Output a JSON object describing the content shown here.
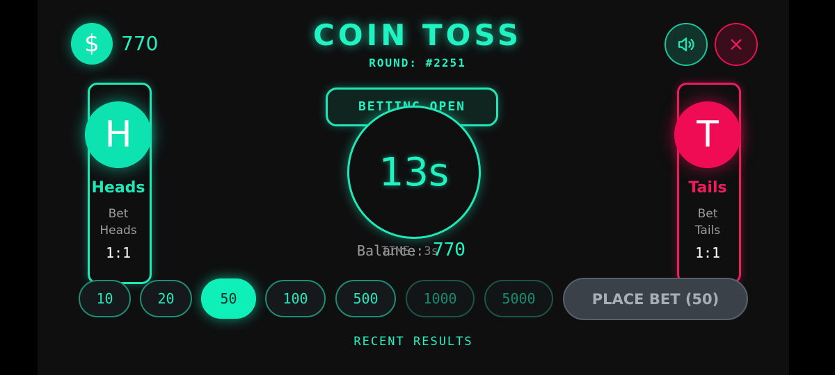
{
  "header": {
    "title": "COIN TOSS",
    "round": "ROUND: #2251",
    "balance": "770",
    "currency_symbol": "$",
    "sound_icon": "speaker-icon",
    "close_icon": "close-icon"
  },
  "heads": {
    "letter": "H",
    "name": "Heads",
    "bet_line1": "Bet",
    "bet_line2": "Heads",
    "odds": "1:1",
    "color": "#1fe8b8"
  },
  "tails": {
    "letter": "T",
    "name": "Tails",
    "bet_line1": "Bet",
    "bet_line2": "Tails",
    "odds": "1:1",
    "color": "#ef1b5e"
  },
  "center": {
    "status": "BETTING OPEN",
    "timer": "13s",
    "balance_label": "Balance:",
    "balance_value": "770",
    "time_label": "TIME: 3s"
  },
  "chips": [
    {
      "label": "10",
      "state": "normal"
    },
    {
      "label": "20",
      "state": "normal"
    },
    {
      "label": "50",
      "state": "selected"
    },
    {
      "label": "100",
      "state": "normal"
    },
    {
      "label": "500",
      "state": "normal"
    },
    {
      "label": "1000",
      "state": "disabled"
    },
    {
      "label": "5000",
      "state": "disabled"
    }
  ],
  "place_bet_label": "PLACE BET (50)",
  "recent_results_label": "RECENT RESULTS",
  "colors": {
    "accent": "#1ff3c2",
    "danger": "#ef1b5e",
    "background": "#0f0f10"
  }
}
